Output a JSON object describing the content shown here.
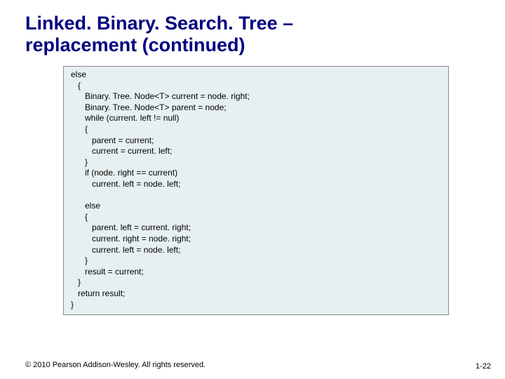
{
  "title_line1": "Linked. Binary. Search. Tree –",
  "title_line2": "replacement (continued)",
  "code": "else\n   {\n      Binary. Tree. Node<T> current = node. right;\n      Binary. Tree. Node<T> parent = node;\n      while (current. left != null)\n      {\n         parent = current;\n         current = current. left;\n      }\n      if (node. right == current)\n         current. left = node. left;\n\n      else\n      {\n         parent. left = current. right;\n         current. right = node. right;\n         current. left = node. left;\n      }\n      result = current;\n   }\n   return result;\n}",
  "copyright": "© 2010 Pearson Addison-Wesley. All rights reserved.",
  "page_number": "1-22"
}
